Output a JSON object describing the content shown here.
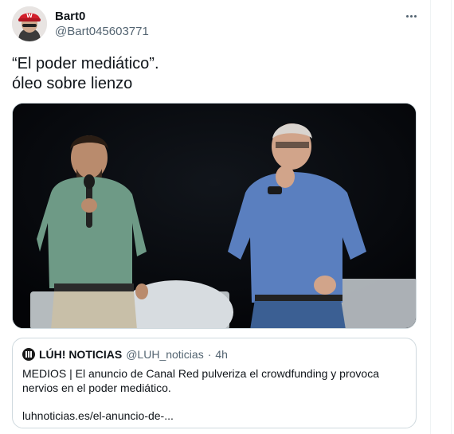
{
  "tweet": {
    "display_name": "Bart0",
    "handle": "@Bart045603771",
    "text": "“El poder mediático”.\nóleo sobre lienzo",
    "more_icon": "more-horizontal-icon",
    "avatar_icon": "avatar-cap-wolf-icon"
  },
  "photo": {
    "icon": "photo-two-men-on-stage"
  },
  "quote": {
    "logo_icon": "luh-logo-icon",
    "name": "LÚH! NOTICIAS",
    "handle": "@LUH_noticias",
    "dot": "·",
    "time": "4h",
    "text": "MEDIOS | El anuncio de Canal Red pulveriza el crowdfunding y provoca nervios en el poder mediático.",
    "link": "luhnoticias.es/el-anuncio-de-..."
  },
  "colors": {
    "text_primary": "#0f1419",
    "text_secondary": "#536471",
    "border": "#cfd9de"
  }
}
